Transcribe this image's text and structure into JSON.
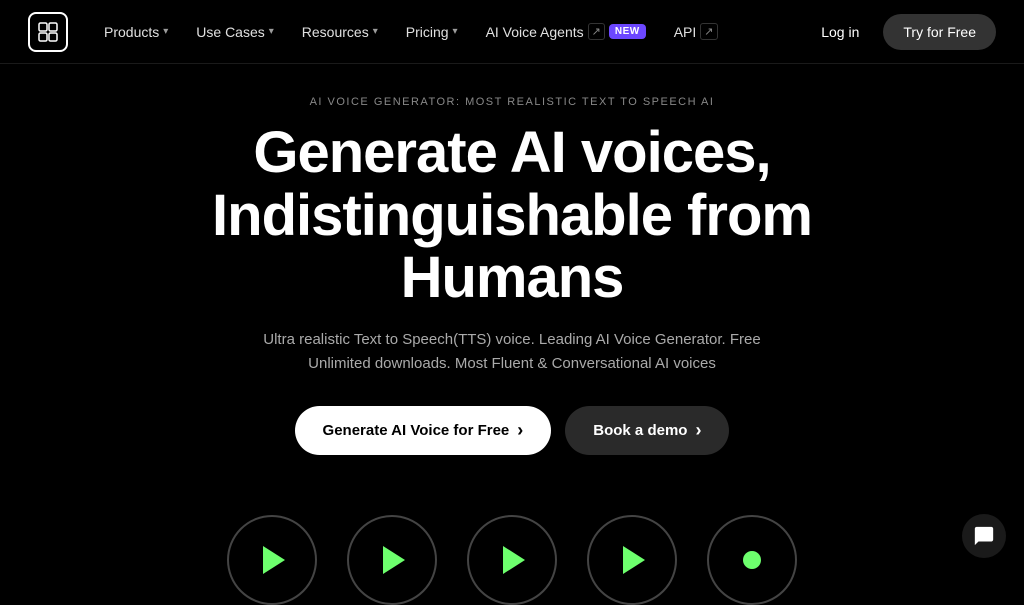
{
  "nav": {
    "logo_icon": "🎲",
    "items": [
      {
        "label": "Products",
        "has_chevron": true,
        "badge": null,
        "ext": false
      },
      {
        "label": "Use Cases",
        "has_chevron": true,
        "badge": null,
        "ext": false
      },
      {
        "label": "Resources",
        "has_chevron": true,
        "badge": null,
        "ext": false
      },
      {
        "label": "Pricing",
        "has_chevron": true,
        "badge": null,
        "ext": false
      },
      {
        "label": "AI Voice Agents",
        "has_chevron": false,
        "badge": "NEW",
        "ext": true
      },
      {
        "label": "API",
        "has_chevron": false,
        "badge": null,
        "ext": true
      }
    ],
    "login_label": "Log in",
    "try_label": "Try for Free"
  },
  "hero": {
    "eyebrow": "AI VOICE GENERATOR: MOST REALISTIC TEXT TO SPEECH AI",
    "title_line1": "Generate AI voices,",
    "title_line2": "Indistinguishable from",
    "title_line3": "Humans",
    "subtitle": "Ultra realistic Text to Speech(TTS) voice. Leading AI Voice Generator. Free Unlimited downloads. Most Fluent & Conversational AI voices",
    "cta_primary": "Generate AI Voice for Free",
    "cta_primary_arrow": "›",
    "cta_secondary": "Book a demo",
    "cta_secondary_arrow": "›"
  },
  "audio_players": [
    {
      "type": "play",
      "id": 1
    },
    {
      "type": "play",
      "id": 2
    },
    {
      "type": "play",
      "id": 3
    },
    {
      "type": "play",
      "id": 4
    },
    {
      "type": "dot",
      "id": 5
    }
  ],
  "chat": {
    "icon": "💬"
  }
}
